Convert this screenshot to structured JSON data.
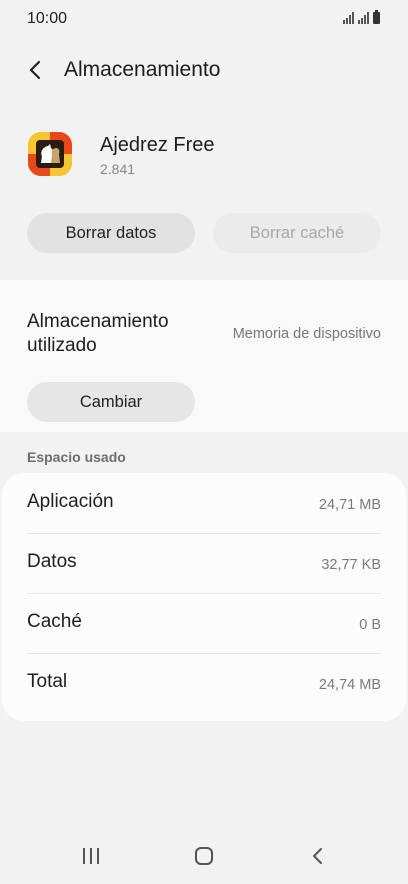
{
  "status_bar": {
    "time": "10:00"
  },
  "header": {
    "title": "Almacenamiento"
  },
  "app": {
    "name": "Ajedrez Free",
    "version": "2.841"
  },
  "actions": {
    "clear_data": "Borrar datos",
    "clear_cache": "Borrar caché"
  },
  "storage": {
    "label": "Almacenamiento utilizado",
    "value": "Memoria de dispositivo",
    "change_button": "Cambiar"
  },
  "usage": {
    "section_title": "Espacio usado",
    "rows": [
      {
        "label": "Aplicación",
        "value": "24,71 MB"
      },
      {
        "label": "Datos",
        "value": "32,77 KB"
      },
      {
        "label": "Caché",
        "value": "0 B"
      },
      {
        "label": "Total",
        "value": "24,74 MB"
      }
    ]
  },
  "colors": {
    "background": "#f1f1f1",
    "card": "#fcfcfc",
    "button": "#e2e2e2",
    "disabled_text": "#a8a8a8"
  },
  "icons": [
    "back-arrow-icon",
    "signal-icon",
    "battery-icon",
    "recent-apps-icon",
    "home-icon",
    "nav-back-icon"
  ]
}
